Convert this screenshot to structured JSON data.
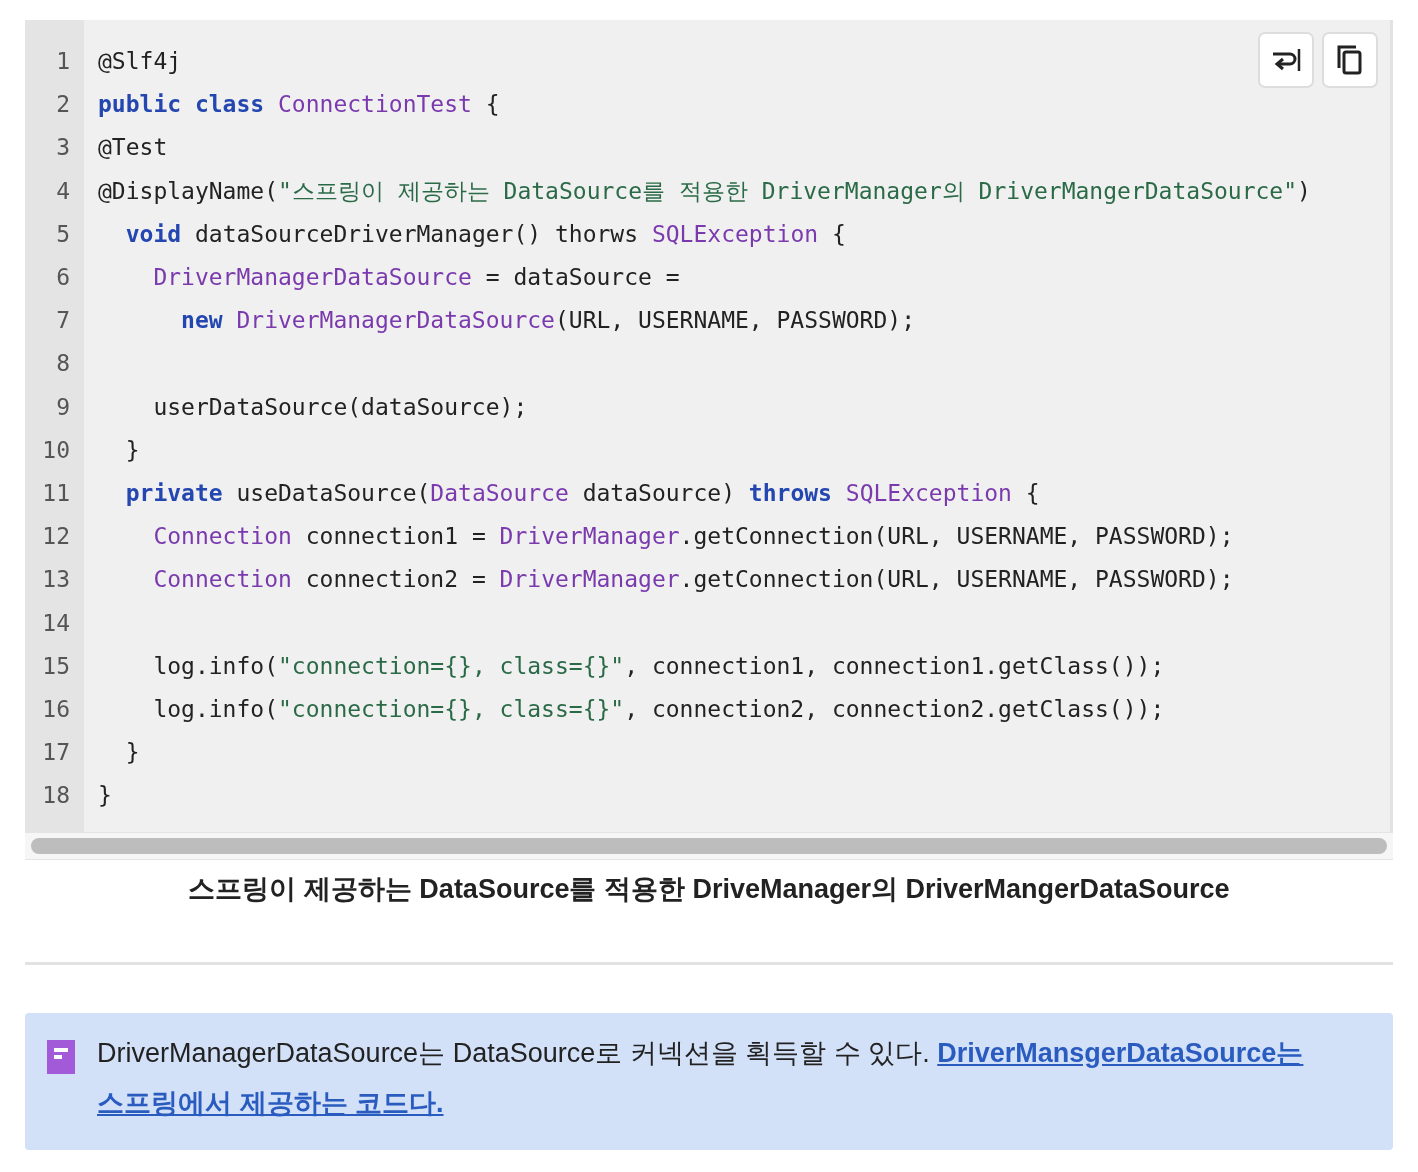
{
  "code_block": {
    "lines": [
      {
        "number": "1",
        "tokens": [
          {
            "kind": "plain",
            "text": "@Slf4j"
          }
        ]
      },
      {
        "number": "2",
        "tokens": [
          {
            "kind": "keyword",
            "text": "public class"
          },
          {
            "kind": "type",
            "text": " ConnectionTest"
          },
          {
            "kind": "plain",
            "text": " {"
          }
        ]
      },
      {
        "number": "3",
        "tokens": [
          {
            "kind": "plain",
            "text": "@Test"
          }
        ]
      },
      {
        "number": "4",
        "tokens": [
          {
            "kind": "plain",
            "text": "@DisplayName("
          },
          {
            "kind": "string",
            "text": "\"스프링이 제공하는 DataSource를 적용한 DriverManager의 DriverMangerDataSource\""
          },
          {
            "kind": "plain",
            "text": ")"
          }
        ]
      },
      {
        "number": "5",
        "tokens": [
          {
            "kind": "keyword",
            "text": "  void"
          },
          {
            "kind": "plain",
            "text": " dataSourceDriverManager() thorws "
          },
          {
            "kind": "type",
            "text": "SQLException"
          },
          {
            "kind": "plain",
            "text": " {"
          }
        ]
      },
      {
        "number": "6",
        "tokens": [
          {
            "kind": "type",
            "text": "    DriverManagerDataSource"
          },
          {
            "kind": "plain",
            "text": " = dataSource ="
          }
        ]
      },
      {
        "number": "7",
        "tokens": [
          {
            "kind": "keyword",
            "text": "      new"
          },
          {
            "kind": "type",
            "text": " DriverManagerDataSource"
          },
          {
            "kind": "plain",
            "text": "(URL, USERNAME, PASSWORD);"
          }
        ]
      },
      {
        "number": "8"
      },
      {
        "number": "9",
        "tokens": [
          {
            "kind": "plain",
            "text": "    userDataSource(dataSource);"
          }
        ]
      },
      {
        "number": "10",
        "tokens": [
          {
            "kind": "plain",
            "text": "  }"
          }
        ]
      },
      {
        "number": "11",
        "tokens": [
          {
            "kind": "keyword",
            "text": "  private"
          },
          {
            "kind": "plain",
            "text": " useDataSource("
          },
          {
            "kind": "type",
            "text": "DataSource"
          },
          {
            "kind": "plain",
            "text": " dataSource) "
          },
          {
            "kind": "keyword",
            "text": "throws"
          },
          {
            "kind": "type",
            "text": " SQLException"
          },
          {
            "kind": "plain",
            "text": " {"
          }
        ]
      },
      {
        "number": "12",
        "tokens": [
          {
            "kind": "type",
            "text": "    Connection"
          },
          {
            "kind": "plain",
            "text": " connection1 = "
          },
          {
            "kind": "type",
            "text": "DriverManager"
          },
          {
            "kind": "plain",
            "text": ".getConnection(URL, USERNAME, PASSWORD);"
          }
        ]
      },
      {
        "number": "13",
        "tokens": [
          {
            "kind": "type",
            "text": "    Connection"
          },
          {
            "kind": "plain",
            "text": " connection2 = "
          },
          {
            "kind": "type",
            "text": "DriverManager"
          },
          {
            "kind": "plain",
            "text": ".getConnection(URL, USERNAME, PASSWORD);"
          }
        ]
      },
      {
        "number": "14"
      },
      {
        "number": "15",
        "tokens": [
          {
            "kind": "plain",
            "text": "    log.info("
          },
          {
            "kind": "string",
            "text": "\"connection={}, class={}\""
          },
          {
            "kind": "plain",
            "text": ", connection1, connection1.getClass());"
          }
        ]
      },
      {
        "number": "16",
        "tokens": [
          {
            "kind": "plain",
            "text": "    log.info("
          },
          {
            "kind": "string",
            "text": "\"connection={}, class={}\""
          },
          {
            "kind": "plain",
            "text": ", connection2, connection2.getClass());"
          }
        ]
      },
      {
        "number": "17",
        "tokens": [
          {
            "kind": "plain",
            "text": "  }"
          }
        ]
      },
      {
        "number": "18",
        "tokens": [
          {
            "kind": "plain",
            "text": "}"
          }
        ]
      }
    ],
    "caption": "스프링이 제공하는 DataSource를 적용한 DriveManager의 DriverMangerDataSource"
  },
  "callout": {
    "text": "DriverManagerDataSource는 DataSource로 커넥션을 획득할 수 있다.",
    "link_lines": [
      "DriverMansgerDataSource는",
      "스프링에서 제공하는 코드다."
    ]
  }
}
